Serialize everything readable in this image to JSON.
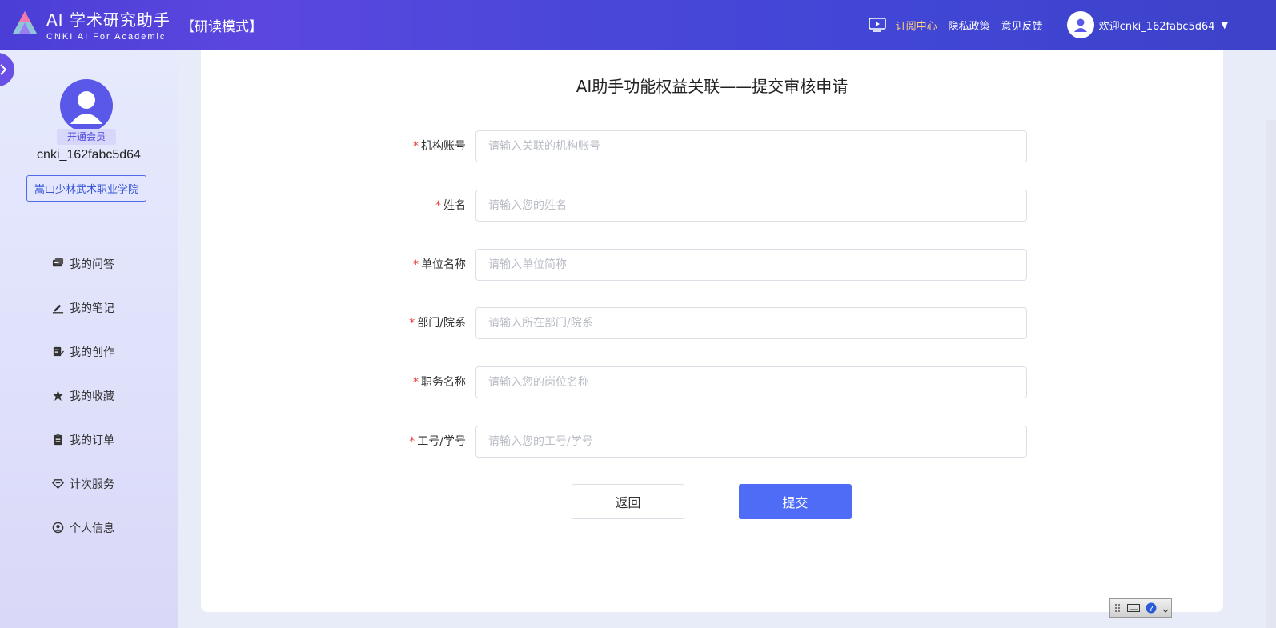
{
  "header": {
    "brand_title": "AI 学术研究助手",
    "brand_sub": "CNKI AI For Academic",
    "mode": "【研读模式】",
    "nav": {
      "subscribe": "订阅中心",
      "privacy": "隐私政策",
      "feedback": "意见反馈"
    },
    "user_greeting": "欢迎cnki_162fabc5d64",
    "accent_color": "#ffd27a"
  },
  "sidebar": {
    "vip_badge": "开通会员",
    "username": "cnki_162fabc5d64",
    "org": "嵩山少林武术职业学院",
    "menu": [
      {
        "label": "我的问答",
        "icon": "chat-icon"
      },
      {
        "label": "我的笔记",
        "icon": "pencil-icon"
      },
      {
        "label": "我的创作",
        "icon": "edit-doc-icon"
      },
      {
        "label": "我的收藏",
        "icon": "star-icon"
      },
      {
        "label": "我的订单",
        "icon": "clipboard-icon"
      },
      {
        "label": "计次服务",
        "icon": "diamond-icon"
      },
      {
        "label": "个人信息",
        "icon": "user-circle-icon"
      }
    ]
  },
  "form": {
    "title": "AI助手功能权益关联——提交审核申请",
    "fields": [
      {
        "label": "机构账号",
        "placeholder": "请输入关联的机构账号",
        "value": ""
      },
      {
        "label": "姓名",
        "placeholder": "请输入您的姓名",
        "value": ""
      },
      {
        "label": "单位名称",
        "placeholder": "请输入单位简称",
        "value": ""
      },
      {
        "label": "部门/院系",
        "placeholder": "请输入所在部门/院系",
        "value": ""
      },
      {
        "label": "职务名称",
        "placeholder": "请输入您的岗位名称",
        "value": ""
      },
      {
        "label": "工号/学号",
        "placeholder": "请输入您的工号/学号",
        "value": ""
      }
    ],
    "required_mark": "*",
    "back_label": "返回",
    "submit_label": "提交",
    "submit_color": "#4f6cf7"
  }
}
